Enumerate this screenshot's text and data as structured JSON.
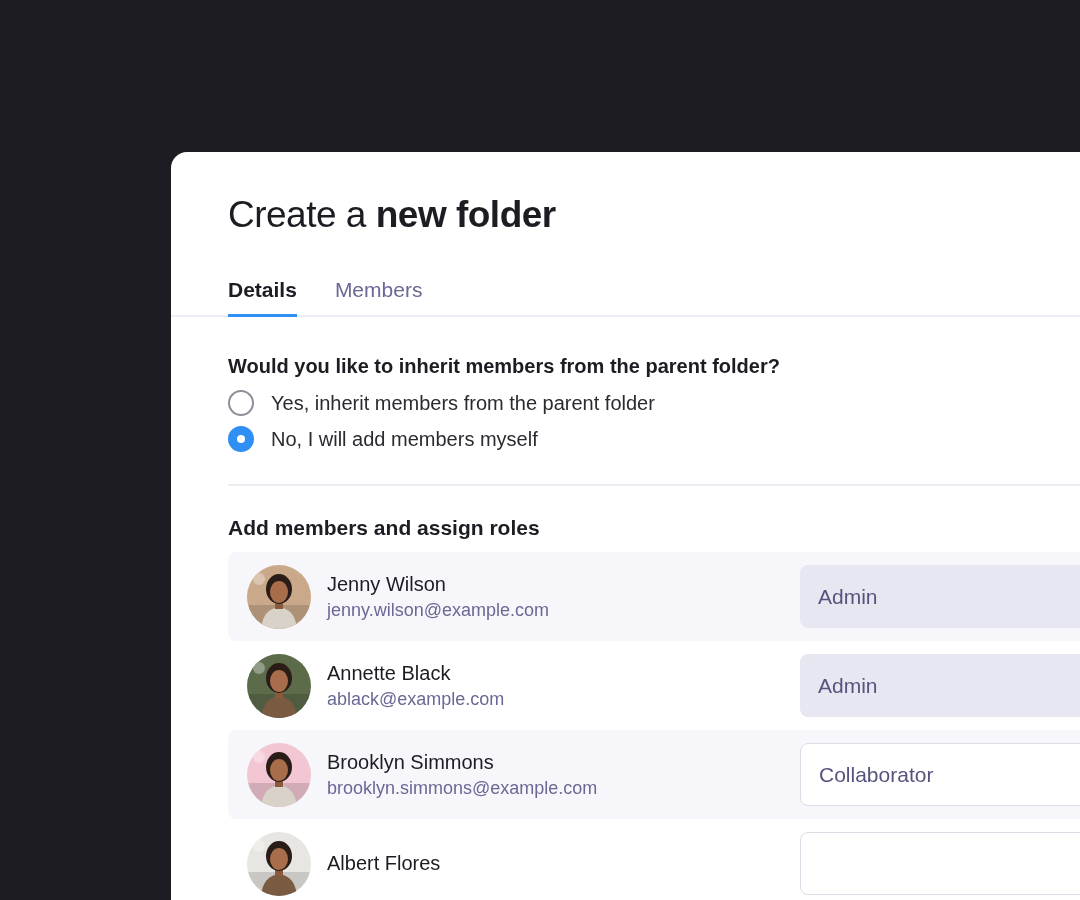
{
  "dialog": {
    "title": "Create a **new folder**"
  },
  "tabs": [
    {
      "label": "Details",
      "selected": true
    },
    {
      "label": "Members",
      "selected": false
    }
  ],
  "inherit_question": "Would you like to inherit members from the parent folder?",
  "inherit_options": [
    {
      "label": "Yes, inherit members from the parent folder",
      "selected": false
    },
    {
      "label": "No, I will add members myself",
      "selected": true
    }
  ],
  "members_heading": "Add members and assign roles",
  "members": [
    {
      "name": "Jenny Wilson",
      "email": "jenny.wilson@example.com",
      "role": "Admin",
      "kind": "filled"
    },
    {
      "name": "Annette Black",
      "email": "ablack@example.com",
      "role": "Admin",
      "kind": "filled"
    },
    {
      "name": "Brooklyn Simmons",
      "email": "brooklyn.simmons@example.com",
      "role": "Collaborator",
      "kind": "outlined"
    },
    {
      "name": "Albert Flores",
      "kind": "outlined"
    }
  ]
}
